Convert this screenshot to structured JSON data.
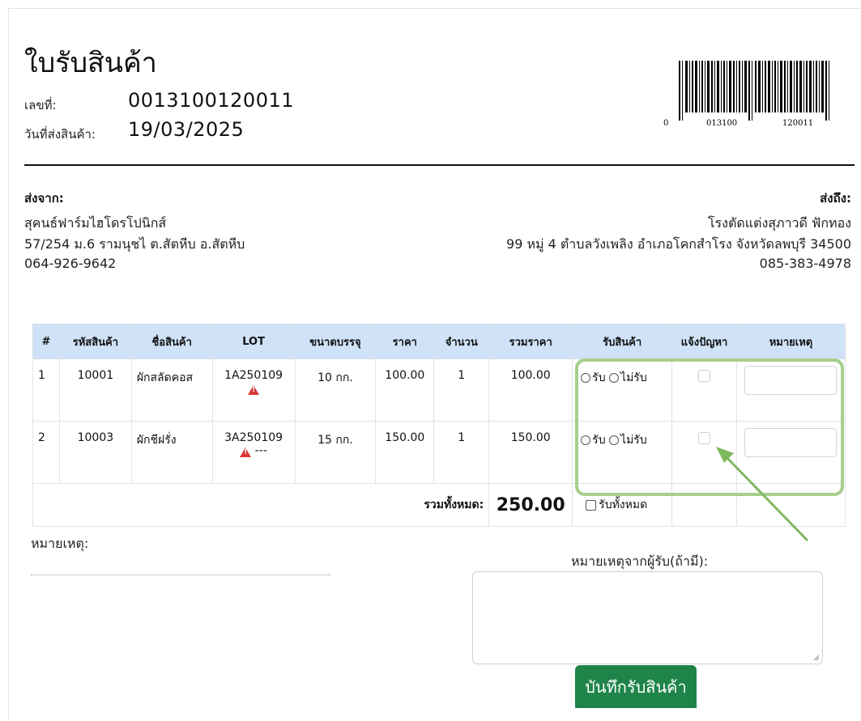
{
  "document": {
    "title": "ใบรับสินค้า",
    "number_label": "เลขที่:",
    "number_value": "0013100120011",
    "date_label": "วันที่ส่งสินค้า:",
    "date_value": "19/03/2025"
  },
  "barcode": {
    "prefix": "0",
    "group1": "013100",
    "group2": "120011"
  },
  "sender": {
    "heading": "ส่งจาก:",
    "name": "สุคนธ์ฟาร์มไฮโดรโปนิกส์",
    "address": "57/254 ม.6 รามนุชไ ต.สัตหีบ อ.สัตหีบ",
    "phone": "064-926-9642"
  },
  "receiver": {
    "heading": "ส่งถึง:",
    "name": "โรงตัดแต่งสุภาวดี ฟักทอง",
    "address": "99 หมู่ 4 ตำบลวังเพลิง อำเภอโคกสำโรง จังหวัดลพบุรี 34500",
    "phone": "085-383-4978"
  },
  "table": {
    "headers": [
      "#",
      "รหัสสินค้า",
      "ชื่อสินค้า",
      "LOT",
      "ขนาดบรรจุ",
      "ราคา",
      "จำนวน",
      "รวมราคา",
      "รับสินค้า",
      "แจ้งปัญหา",
      "หมายเหตุ"
    ],
    "rows": [
      {
        "no": "1",
        "code": "10001",
        "name": "ผักสลัดคอส",
        "lot": "1A250109",
        "lot_extra": "",
        "size": "10 กก.",
        "price": "100.00",
        "qty": "1",
        "total": "100.00"
      },
      {
        "no": "2",
        "code": "10003",
        "name": "ผักชีฝรั่ง",
        "lot": "3A250109",
        "lot_extra": "---",
        "size": "15 กก.",
        "price": "150.00",
        "qty": "1",
        "total": "150.00"
      }
    ],
    "receive_label": "รับ",
    "reject_label": "ไม่รับ",
    "grand_total_label": "รวมทั้งหมด:",
    "grand_total_value": "250.00",
    "receive_all_label": "รับทั้งหมด"
  },
  "remarks": {
    "label": "หมายเหตุ:",
    "receiver_label": "หมายเหตุจากผู้รับ(ถ้ามี):"
  },
  "actions": {
    "save_label": "บันทึกรับสินค้า"
  },
  "colors": {
    "header_bg": "#cfe2f7",
    "highlight": "#a7cf8c",
    "save_button": "#1e8449",
    "warning": "#d93636"
  }
}
